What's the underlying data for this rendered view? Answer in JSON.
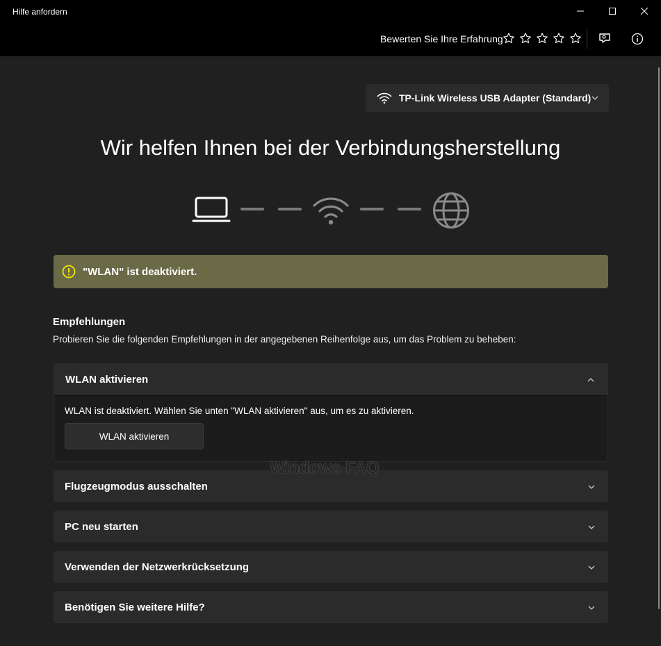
{
  "window": {
    "title": "Hilfe anfordern",
    "controls": {
      "minimize_icon": "minimize-icon",
      "maximize_icon": "maximize-icon",
      "close_icon": "close-icon"
    }
  },
  "toolbar": {
    "rate_label": "Bewerten Sie Ihre Erfahrung",
    "stars": [
      {
        "icon": "star-icon",
        "filled": false
      },
      {
        "icon": "star-icon",
        "filled": false
      },
      {
        "icon": "star-icon",
        "filled": false
      },
      {
        "icon": "star-icon",
        "filled": false
      },
      {
        "icon": "star-icon",
        "filled": false
      }
    ],
    "feedback_icon": "feedback-icon",
    "info_icon": "info-icon"
  },
  "adapter": {
    "icon": "wifi-icon",
    "selected": "TP-Link Wireless USB Adapter (Standard)"
  },
  "headline": "Wir helfen Ihnen bei der Verbindungsherstellung",
  "diagram": {
    "nodes": [
      "laptop-icon",
      "wifi-icon",
      "globe-icon"
    ]
  },
  "warning": {
    "icon": "warning-icon",
    "text": "\"WLAN\" ist deaktiviert."
  },
  "recommendations": {
    "title": "Empfehlungen",
    "subtitle": "Probieren Sie die folgenden Empfehlungen in der angegebenen Reihenfolge aus, um das Problem zu beheben:",
    "items": [
      {
        "label": "WLAN aktivieren",
        "expanded": true,
        "body": "WLAN ist deaktiviert. Wählen Sie unten \"WLAN aktivieren\" aus, um es zu aktivieren.",
        "button": "WLAN aktivieren"
      },
      {
        "label": "Flugzeugmodus ausschalten",
        "expanded": false
      },
      {
        "label": "PC neu starten",
        "expanded": false
      },
      {
        "label": "Verwenden der Netzwerkrücksetzung",
        "expanded": false
      },
      {
        "label": "Benötigen Sie weitere Hilfe?",
        "expanded": false
      }
    ]
  },
  "watermark": "Windows-FAQ",
  "colors": {
    "background": "#202020",
    "titlebar": "#000000",
    "warning_bg": "#6b6a47",
    "warning_icon": "#f2e600",
    "panel_bg": "#2b2b2b"
  }
}
